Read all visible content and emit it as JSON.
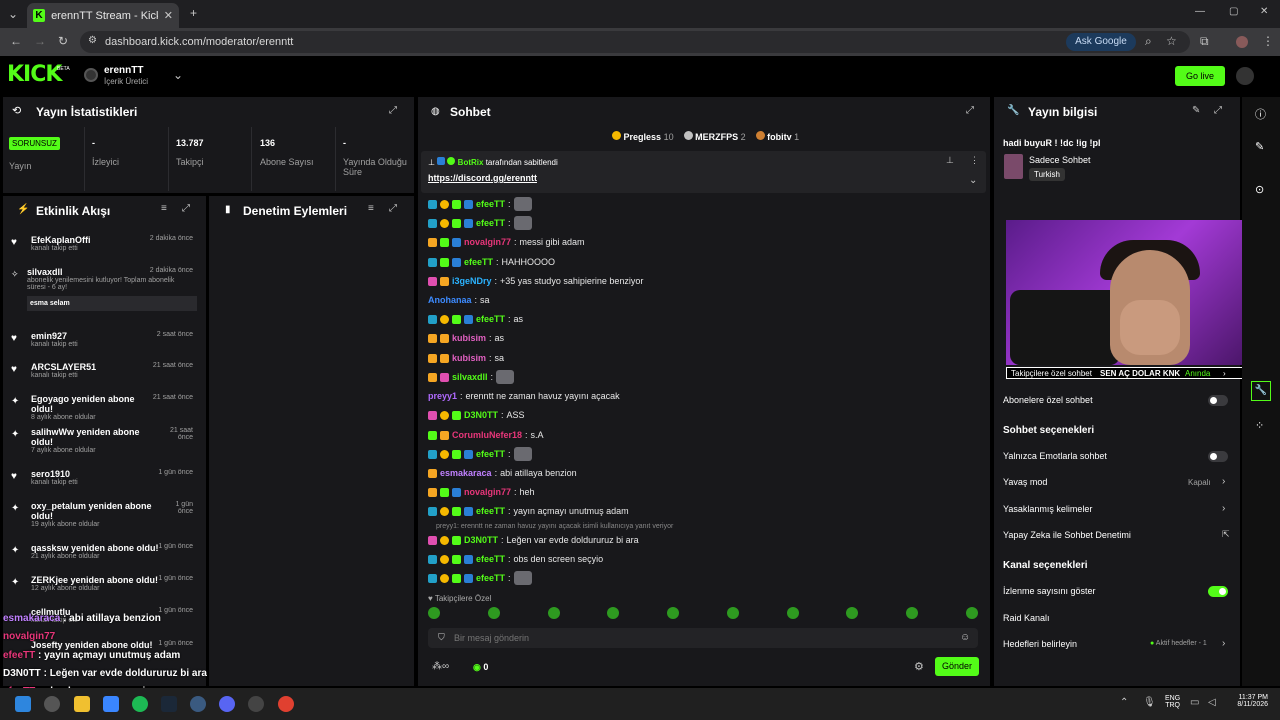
{
  "browser": {
    "tab_title": "erennTT Stream - Kick Dashboard",
    "url": "dashboard.kick.com/moderator/erenntt",
    "ask_google": "Ask Google"
  },
  "header": {
    "logo": "KICK",
    "beta": "BETA",
    "username": "erennTT",
    "role": "İçerik Üretici",
    "go_live": "Go live"
  },
  "stats": {
    "title": "Yayın İstatistikleri",
    "cells": [
      {
        "value": "SORUNSUZ",
        "label": "Yayın"
      },
      {
        "value": "-",
        "label": "İzleyici"
      },
      {
        "value": "13.787",
        "label": "Takipçi"
      },
      {
        "value": "136",
        "label": "Abone Sayısı"
      },
      {
        "value": "-",
        "label": "Yayında Olduğu Süre"
      }
    ]
  },
  "activity": {
    "title": "Etkinlik Akışı",
    "items": [
      {
        "name": "EfeKaplanOffi",
        "sub": "kanalı takip etti",
        "time": "2 dakika önce"
      },
      {
        "name": "silvaxdll",
        "sub": "abonelik yenilemesini kutluyor! Toplam abonelik süresi - 6 ay!",
        "time": "2 dakika önce",
        "note": "esma selam"
      },
      {
        "name": "emin927",
        "sub": "kanalı takip etti",
        "time": "2 saat önce"
      },
      {
        "name": "ARCSLAYER51",
        "sub": "kanalı takip etti",
        "time": "21 saat önce"
      },
      {
        "name": "Egoyago yeniden abone oldu!",
        "sub": "8 aylık abone oldular",
        "time": "21 saat önce"
      },
      {
        "name": "salihwWw yeniden abone oldu!",
        "sub": "7 aylık abone oldular",
        "time": "21 saat önce"
      },
      {
        "name": "sero1910",
        "sub": "kanalı takip etti",
        "time": "1 gün önce"
      },
      {
        "name": "oxy_petalum yeniden abone oldu!",
        "sub": "19 aylık abone oldular",
        "time": "1 gün önce"
      },
      {
        "name": "qassksw yeniden abone oldu!",
        "sub": "21 aylık abone oldular",
        "time": "1 gün önce"
      },
      {
        "name": "ZERKjee yeniden abone oldu!",
        "sub": "12 aylık abone oldular",
        "time": "1 gün önce"
      },
      {
        "name": "cellmutlu",
        "sub": "kanalı takip etti",
        "time": "1 gün önce"
      },
      {
        "name": "Josefty yeniden abone oldu!",
        "sub": "",
        "time": "1 gün önce"
      }
    ]
  },
  "mod": {
    "title": "Denetim Eylemleri"
  },
  "chat": {
    "title": "Sohbet",
    "top": [
      {
        "name": "Pregless",
        "count": "10"
      },
      {
        "name": "MERZFPS",
        "count": "2"
      },
      {
        "name": "fobitv",
        "count": "1"
      }
    ],
    "pinned_by": "BotRix",
    "pinned_label": "tarafından sabitlendi",
    "pinned_link": "https://discord.gg/erenntt",
    "messages": [
      {
        "name": "efeeTT",
        "color": "#53fc18",
        "text": ""
      },
      {
        "name": "efeeTT",
        "color": "#53fc18",
        "text": ""
      },
      {
        "name": "novalgin77",
        "color": "#e8367a",
        "text": "messi gibi adam"
      },
      {
        "name": "efeeTT",
        "color": "#53fc18",
        "text": "HAHHOOOO"
      },
      {
        "name": "i3geNDry",
        "color": "#2bb3ff",
        "text": "+35 yas studyo sahipierine benziyor"
      },
      {
        "name": "Anohanaa",
        "color": "#3d8bff",
        "text": "sa"
      },
      {
        "name": "efeeTT",
        "color": "#53fc18",
        "text": "as"
      },
      {
        "name": "kubisim",
        "color": "#e060c0",
        "text": "as"
      },
      {
        "name": "kubisim",
        "color": "#e060c0",
        "text": "sa"
      },
      {
        "name": "silvaxdll",
        "color": "#53fc18",
        "text": ""
      },
      {
        "name": "preyy1",
        "color": "#b06aff",
        "text": "erenntt ne zaman havuz yayını açacak"
      },
      {
        "name": "D3N0TT",
        "color": "#53fc18",
        "text": "ASS"
      },
      {
        "name": "CorumluNefer18",
        "color": "#e8367a",
        "text": "s.A"
      },
      {
        "name": "efeeTT",
        "color": "#53fc18",
        "text": ""
      },
      {
        "name": "esmakaraca",
        "color": "#c080ff",
        "text": "abi atillaya benzion"
      },
      {
        "name": "novalgin77",
        "color": "#e8367a",
        "text": "heh"
      },
      {
        "name": "efeeTT",
        "color": "#53fc18",
        "text": "yayın açmayı unutmuş adam"
      },
      {
        "name": "D3N0TT",
        "color": "#53fc18",
        "text": "Leğen var evde doldururuz bi ara"
      },
      {
        "name": "efeeTT",
        "color": "#53fc18",
        "text": "obs den screen seçyio"
      },
      {
        "name": "efeeTT",
        "color": "#53fc18",
        "text": ""
      }
    ],
    "reply_note": "preyy1: erenntt ne zaman havuz yayını açacak isimli kullanıcıya yanıt veriyor",
    "followers_only": "Takipçilere Özel",
    "placeholder": "Bir mesaj gönderin",
    "count": "0",
    "send": "Gönder"
  },
  "info": {
    "title": "Yayın bilgisi",
    "stream_title": "hadi buyuR ! !dc !ig !pl",
    "category": "Sadece Sohbet",
    "tag": "Turkish",
    "followers_chat": "Takipçilere özel sohbet",
    "subs_chat": "Abonelere özel sohbet",
    "chat_options": "Sohbet seçenekleri",
    "emote_only": "Yalnızca Emotlarla sohbet",
    "slow_mode": "Yavaş mod",
    "slow_value": "Kapalı",
    "banned_words": "Yasaklanmış kelimeler",
    "ai_mod": "Yapay Zeka ile Sohbet Denetimi",
    "channel_options": "Kanal seçenekleri",
    "show_viewers": "İzlenme sayısını göster",
    "raid": "Raid Kanalı",
    "goals": "Hedefleri belirleyin",
    "goals_value": "Aktif hedefler - 1",
    "ticker_text": "SEN AÇ DOLAR KNK",
    "ticker_time": "Anında",
    "ticker_count": "10"
  },
  "overlay": [
    {
      "name": "esmakaraca",
      "text": "abi atillaya benzion"
    },
    {
      "name": "novalgin77",
      "text": ""
    },
    {
      "name": "efeeTT",
      "text": "yayın açmayı unutmuş adam"
    },
    {
      "name": "D3N0TT",
      "text": "Leğen var evde doldururuz bi ara"
    },
    {
      "name": "efeeTT",
      "text": "obs den screen seçyio"
    },
    {
      "name": "efeeTT",
      "text": ""
    }
  ],
  "taskbar": {
    "lang": "ENG",
    "region": "TRQ",
    "time": "11:37 PM",
    "date": "8/11/2026"
  },
  "colors": {
    "accent": "#53fc18",
    "panel": "#18181b",
    "bg": "#000000"
  }
}
